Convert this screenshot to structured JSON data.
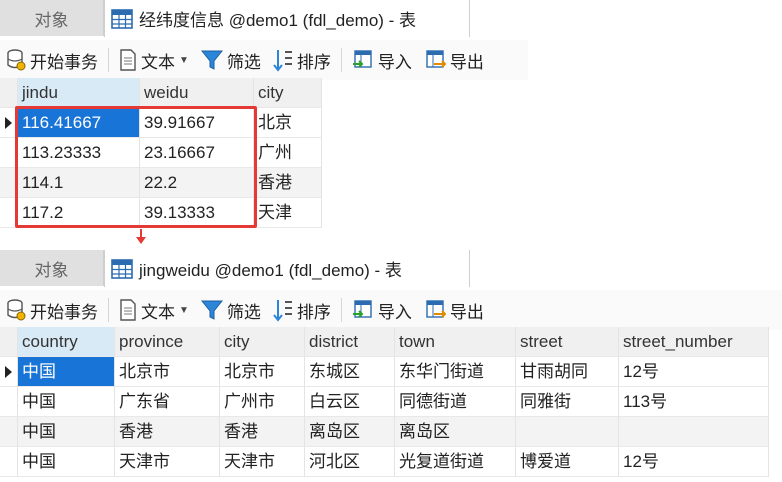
{
  "top": {
    "tabs": {
      "inactive": "对象",
      "active": "经纬度信息 @demo1 (fdl_demo) - 表"
    },
    "toolbar": {
      "begin": "开始事务",
      "text": "文本",
      "filter": "筛选",
      "sort": "排序",
      "import": "导入",
      "export": "导出"
    },
    "columns": [
      "jindu",
      "weidu",
      "city"
    ],
    "rows": [
      [
        "116.41667",
        "39.91667",
        "北京"
      ],
      [
        "113.23333",
        "23.16667",
        "广州"
      ],
      [
        "114.1",
        "22.2",
        "香港"
      ],
      [
        "117.2",
        "39.13333",
        "天津"
      ]
    ]
  },
  "bottom": {
    "tabs": {
      "inactive": "对象",
      "active": "jingweidu @demo1 (fdl_demo) - 表"
    },
    "toolbar": {
      "begin": "开始事务",
      "text": "文本",
      "filter": "筛选",
      "sort": "排序",
      "import": "导入",
      "export": "导出"
    },
    "columns": [
      "country",
      "province",
      "city",
      "district",
      "town",
      "street",
      "street_number"
    ],
    "rows": [
      [
        "中国",
        "北京市",
        "北京市",
        "东城区",
        "东华门街道",
        "甘雨胡同",
        "12号"
      ],
      [
        "中国",
        "广东省",
        "广州市",
        "白云区",
        "同德街道",
        "同雅街",
        "113号"
      ],
      [
        "中国",
        "香港",
        "香港",
        "离岛区",
        "离岛区",
        "",
        ""
      ],
      [
        "中国",
        "天津市",
        "天津市",
        "河北区",
        "光复道街道",
        "博爱道",
        "12号"
      ]
    ]
  },
  "colors": {
    "highlight": "#e53935",
    "selection": "#1874d6"
  }
}
